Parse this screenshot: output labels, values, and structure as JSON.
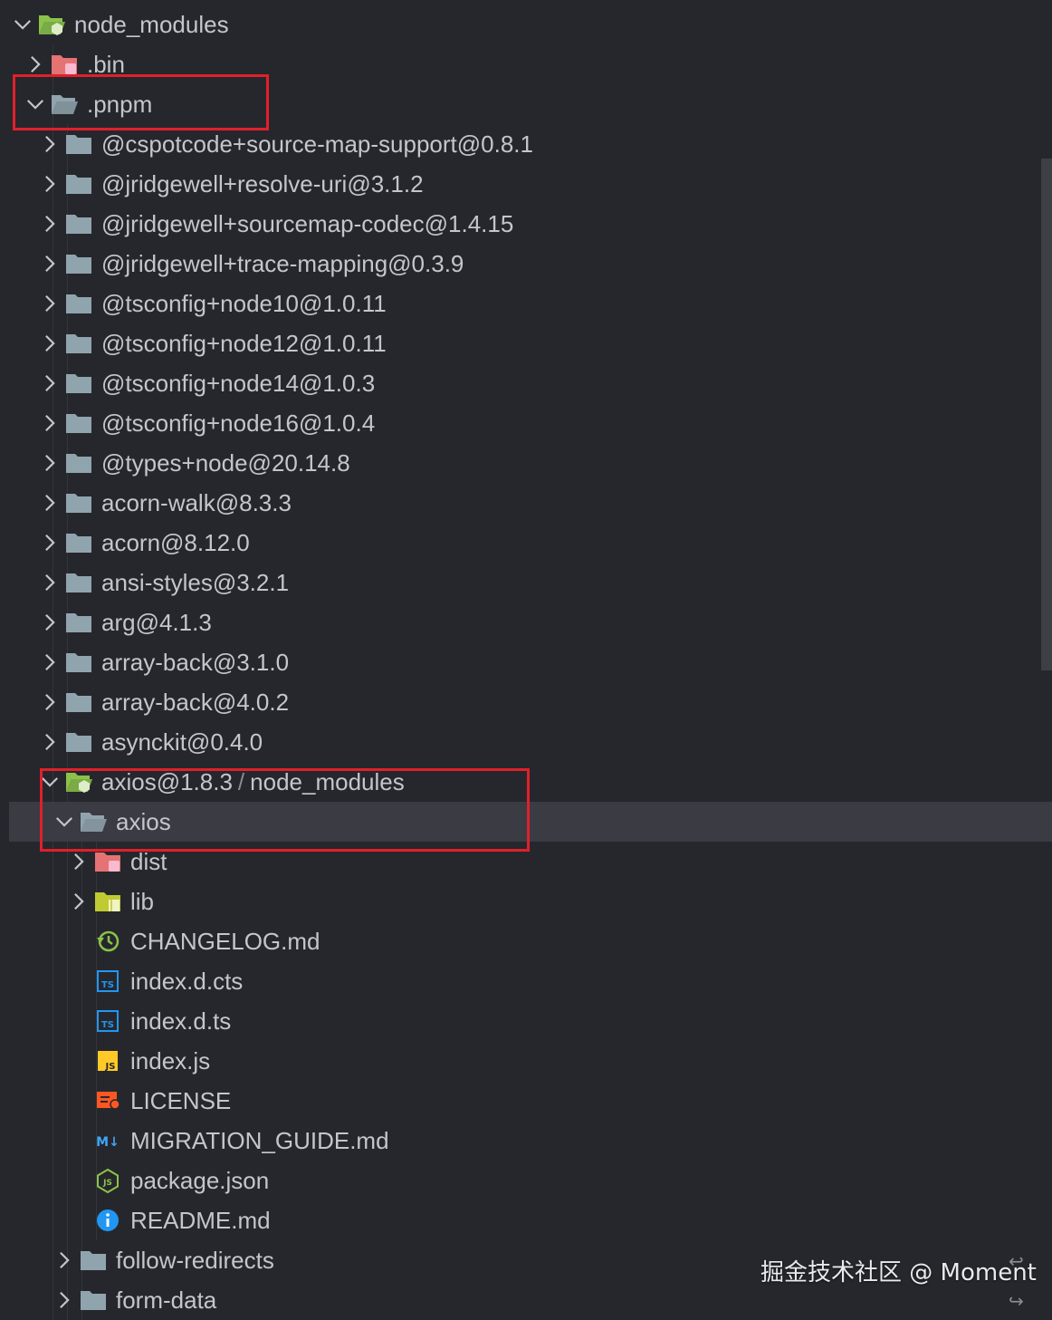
{
  "tree": [
    {
      "label": "node_modules",
      "depth": 0,
      "expanded": true,
      "icon": "folder-node-open-icon"
    },
    {
      "label": ".bin",
      "depth": 1,
      "expanded": false,
      "icon": "folder-bin-icon"
    },
    {
      "label": ".pnpm",
      "depth": 1,
      "expanded": true,
      "icon": "folder-open-icon"
    },
    {
      "label": "@cspotcode+source-map-support@0.8.1",
      "depth": 2,
      "expanded": false,
      "icon": "folder-icon"
    },
    {
      "label": "@jridgewell+resolve-uri@3.1.2",
      "depth": 2,
      "expanded": false,
      "icon": "folder-icon"
    },
    {
      "label": "@jridgewell+sourcemap-codec@1.4.15",
      "depth": 2,
      "expanded": false,
      "icon": "folder-icon"
    },
    {
      "label": "@jridgewell+trace-mapping@0.3.9",
      "depth": 2,
      "expanded": false,
      "icon": "folder-icon"
    },
    {
      "label": "@tsconfig+node10@1.0.11",
      "depth": 2,
      "expanded": false,
      "icon": "folder-icon"
    },
    {
      "label": "@tsconfig+node12@1.0.11",
      "depth": 2,
      "expanded": false,
      "icon": "folder-icon"
    },
    {
      "label": "@tsconfig+node14@1.0.3",
      "depth": 2,
      "expanded": false,
      "icon": "folder-icon"
    },
    {
      "label": "@tsconfig+node16@1.0.4",
      "depth": 2,
      "expanded": false,
      "icon": "folder-icon"
    },
    {
      "label": "@types+node@20.14.8",
      "depth": 2,
      "expanded": false,
      "icon": "folder-icon"
    },
    {
      "label": "acorn-walk@8.3.3",
      "depth": 2,
      "expanded": false,
      "icon": "folder-icon"
    },
    {
      "label": "acorn@8.12.0",
      "depth": 2,
      "expanded": false,
      "icon": "folder-icon"
    },
    {
      "label": "ansi-styles@3.2.1",
      "depth": 2,
      "expanded": false,
      "icon": "folder-icon"
    },
    {
      "label": "arg@4.1.3",
      "depth": 2,
      "expanded": false,
      "icon": "folder-icon"
    },
    {
      "label": "array-back@3.1.0",
      "depth": 2,
      "expanded": false,
      "icon": "folder-icon"
    },
    {
      "label": "array-back@4.0.2",
      "depth": 2,
      "expanded": false,
      "icon": "folder-icon"
    },
    {
      "label": "asynckit@0.4.0",
      "depth": 2,
      "expanded": false,
      "icon": "folder-icon"
    },
    {
      "label": "axios@1.8.3",
      "compact_suffix": "node_modules",
      "depth": 2,
      "expanded": true,
      "icon": "folder-node-open-icon"
    },
    {
      "label": "axios",
      "depth": 3,
      "expanded": true,
      "icon": "folder-open-icon",
      "selected": true
    },
    {
      "label": "dist",
      "depth": 4,
      "expanded": false,
      "icon": "folder-dist-icon"
    },
    {
      "label": "lib",
      "depth": 4,
      "expanded": false,
      "icon": "folder-lib-icon"
    },
    {
      "label": "CHANGELOG.md",
      "depth": 4,
      "file": true,
      "icon": "changelog-icon"
    },
    {
      "label": "index.d.cts",
      "depth": 4,
      "file": true,
      "icon": "typescript-icon"
    },
    {
      "label": "index.d.ts",
      "depth": 4,
      "file": true,
      "icon": "typescript-icon"
    },
    {
      "label": "index.js",
      "depth": 4,
      "file": true,
      "icon": "javascript-icon"
    },
    {
      "label": "LICENSE",
      "depth": 4,
      "file": true,
      "icon": "license-icon"
    },
    {
      "label": "MIGRATION_GUIDE.md",
      "depth": 4,
      "file": true,
      "icon": "markdown-icon"
    },
    {
      "label": "package.json",
      "depth": 4,
      "file": true,
      "icon": "nodejs-icon"
    },
    {
      "label": "README.md",
      "depth": 4,
      "file": true,
      "icon": "info-icon"
    },
    {
      "label": "follow-redirects",
      "depth": 3,
      "expanded": false,
      "icon": "folder-icon"
    },
    {
      "label": "form-data",
      "depth": 3,
      "expanded": false,
      "icon": "folder-icon"
    }
  ],
  "compact_separator": "/",
  "watermark": "掘金技术社区 @ Moment",
  "colors": {
    "background": "#26272c",
    "selected_row": "#3a3b43",
    "highlight_box": "#e0202a",
    "folder": "#90a4ae",
    "folder_node": "#8bc34a",
    "folder_bin": "#e57373",
    "folder_lib": "#c0ca33",
    "typescript": "#2196f3",
    "javascript": "#ffca28",
    "license": "#ff5722",
    "markdown": "#42a5f5",
    "info": "#2196f3"
  }
}
